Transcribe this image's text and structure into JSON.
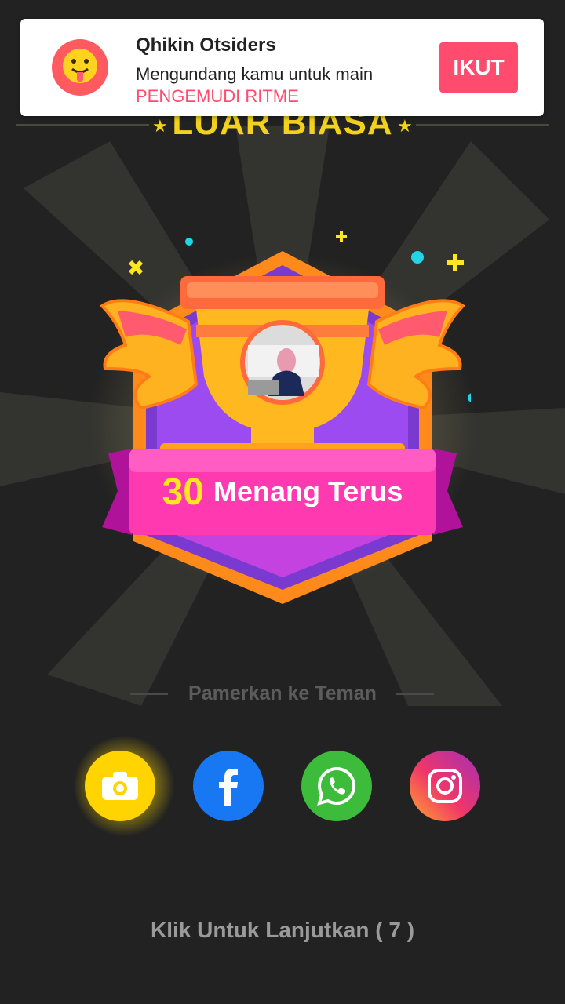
{
  "notification": {
    "name": "Qhikin Otsiders",
    "message_prefix": "Mengundang kamu untuk main",
    "game_name": "PENGEMUDI RITME",
    "follow_label": "IKUT"
  },
  "header": {
    "title": "LUAR BIASA"
  },
  "badge": {
    "streak_count": "30",
    "streak_label": "Menang Terus"
  },
  "share": {
    "heading": "Pamerkan ke Teman",
    "buttons": [
      {
        "icon": "camera-icon",
        "color": "#FFD400"
      },
      {
        "icon": "facebook-icon",
        "color": "#1877F2"
      },
      {
        "icon": "whatsapp-icon",
        "color": "#3DBB3A"
      },
      {
        "icon": "instagram-icon",
        "color": "#C2278F"
      }
    ]
  },
  "footer": {
    "continue_label": "Klik Untuk Lanjutkan ( 7 )"
  },
  "colors": {
    "accent_pink": "#FF4B6E",
    "title_yellow": "#F2D21C",
    "background": "#222222"
  }
}
